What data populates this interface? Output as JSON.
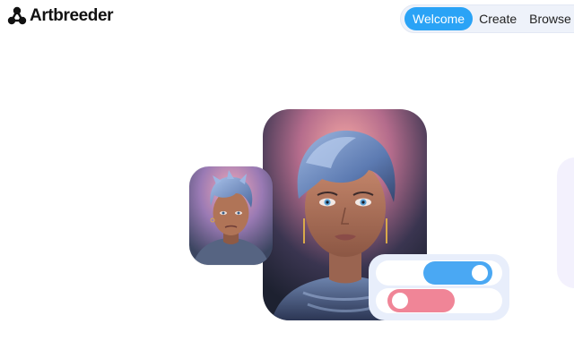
{
  "header": {
    "logo_text": "Artbreeder",
    "logo_icon": "artbreeder-nodes-icon"
  },
  "nav": {
    "tabs": [
      {
        "label": "Welcome",
        "active": true
      },
      {
        "label": "Create",
        "active": false
      },
      {
        "label": "Browse",
        "active": false
      }
    ]
  },
  "hero": {
    "toggles": [
      {
        "state": "on",
        "color": "#4aa8f3"
      },
      {
        "state": "off",
        "color": "#f08597"
      }
    ]
  },
  "colors": {
    "accent": "#2aa3f6",
    "nav_background": "#eef2fa",
    "toggle_card": "#e8eefb"
  }
}
